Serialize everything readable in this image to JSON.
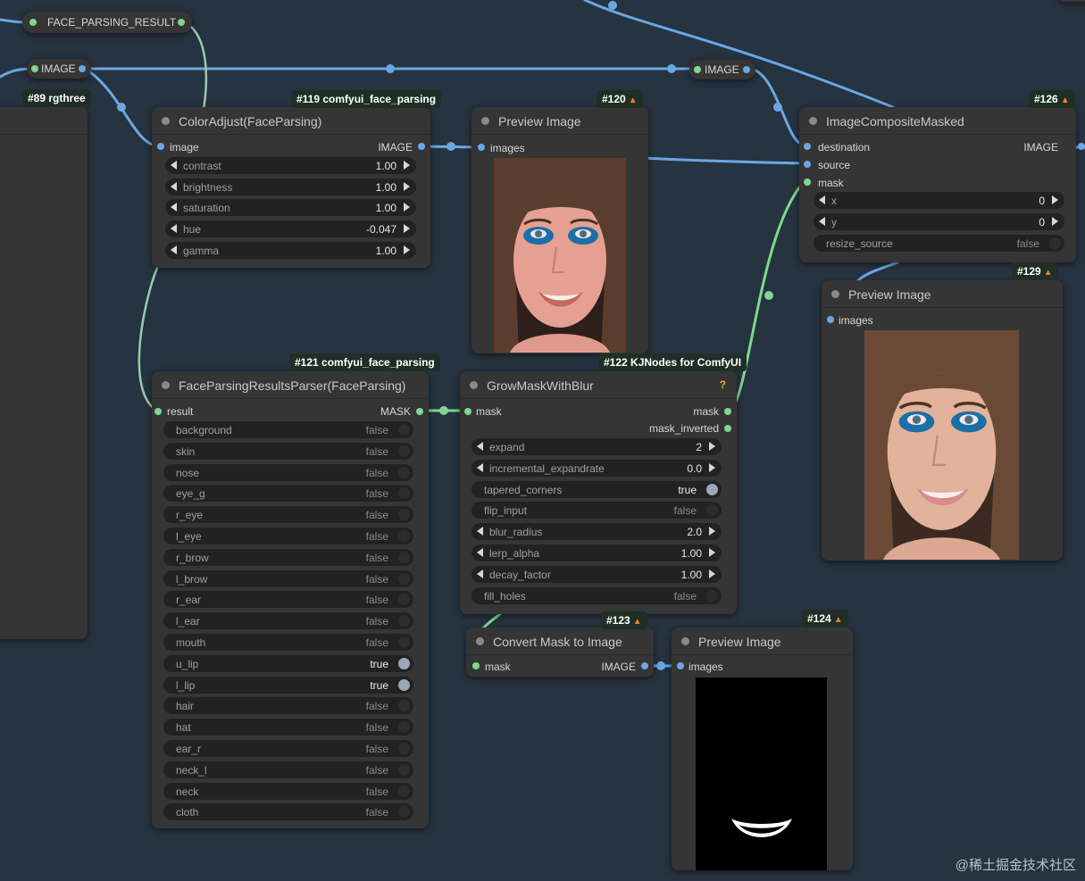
{
  "canvas": {
    "reroutes": [
      {
        "label": "FACE_PARSING_RESULT"
      },
      {
        "label": "IMAGE"
      },
      {
        "label": "IMAGE"
      }
    ]
  },
  "nodes": {
    "rgthree": {
      "badge": "#89 rgthree"
    },
    "color_adjust": {
      "badge": "#119 comfyui_face_parsing",
      "title": "ColorAdjust(FaceParsing)",
      "input": "image",
      "output": "IMAGE",
      "widgets": [
        {
          "label": "contrast",
          "value": "1.00"
        },
        {
          "label": "brightness",
          "value": "1.00"
        },
        {
          "label": "saturation",
          "value": "1.00"
        },
        {
          "label": "hue",
          "value": "-0.047"
        },
        {
          "label": "gamma",
          "value": "1.00"
        }
      ]
    },
    "preview_120": {
      "badge": "#120",
      "title": "Preview Image",
      "input": "images"
    },
    "composite": {
      "badge": "#126",
      "title": "ImageCompositeMasked",
      "inputs": [
        "destination",
        "source",
        "mask"
      ],
      "output": "IMAGE",
      "widgets": [
        {
          "label": "x",
          "value": "0"
        },
        {
          "label": "y",
          "value": "0"
        }
      ],
      "toggle": {
        "label": "resize_source",
        "value": "false"
      }
    },
    "preview_129": {
      "badge": "#129",
      "title": "Preview Image",
      "input": "images"
    },
    "parser": {
      "badge": "#121 comfyui_face_parsing",
      "title": "FaceParsingResultsParser(FaceParsing)",
      "input": "result",
      "output": "MASK",
      "toggles": [
        {
          "label": "background",
          "value": "false"
        },
        {
          "label": "skin",
          "value": "false"
        },
        {
          "label": "nose",
          "value": "false"
        },
        {
          "label": "eye_g",
          "value": "false"
        },
        {
          "label": "r_eye",
          "value": "false"
        },
        {
          "label": "l_eye",
          "value": "false"
        },
        {
          "label": "r_brow",
          "value": "false"
        },
        {
          "label": "l_brow",
          "value": "false"
        },
        {
          "label": "r_ear",
          "value": "false"
        },
        {
          "label": "l_ear",
          "value": "false"
        },
        {
          "label": "mouth",
          "value": "false"
        },
        {
          "label": "u_lip",
          "value": "true"
        },
        {
          "label": "l_lip",
          "value": "true"
        },
        {
          "label": "hair",
          "value": "false"
        },
        {
          "label": "hat",
          "value": "false"
        },
        {
          "label": "ear_r",
          "value": "false"
        },
        {
          "label": "neck_l",
          "value": "false"
        },
        {
          "label": "neck",
          "value": "false"
        },
        {
          "label": "cloth",
          "value": "false"
        }
      ]
    },
    "grow_mask": {
      "badge": "#122 KJNodes for ComfyUI",
      "title": "GrowMaskWithBlur",
      "warning": "?",
      "input": "mask",
      "outputs": [
        "mask",
        "mask_inverted"
      ],
      "widgets": [
        {
          "label": "expand",
          "value": "2",
          "kind": "num"
        },
        {
          "label": "incremental_expandrate",
          "value": "0.0",
          "kind": "num"
        },
        {
          "label": "tapered_corners",
          "value": "true",
          "kind": "toggle"
        },
        {
          "label": "flip_input",
          "value": "false",
          "kind": "toggle"
        },
        {
          "label": "blur_radius",
          "value": "2.0",
          "kind": "num"
        },
        {
          "label": "lerp_alpha",
          "value": "1.00",
          "kind": "num"
        },
        {
          "label": "decay_factor",
          "value": "1.00",
          "kind": "num"
        },
        {
          "label": "fill_holes",
          "value": "false",
          "kind": "toggle"
        }
      ]
    },
    "convert": {
      "badge": "#123",
      "title": "Convert Mask to Image",
      "input": "mask",
      "output": "IMAGE"
    },
    "preview_124": {
      "badge": "#124",
      "title": "Preview Image",
      "input": "images"
    }
  },
  "icons": {
    "fox": "fox-icon",
    "node_status": "circle-icon"
  },
  "colors": {
    "canvas": "#263340",
    "node": "#353535",
    "wire_image": "#6aa7e3",
    "wire_mask": "#7ed88f",
    "badge": "#1f2f25"
  },
  "watermark": "@稀土掘金技术社区"
}
